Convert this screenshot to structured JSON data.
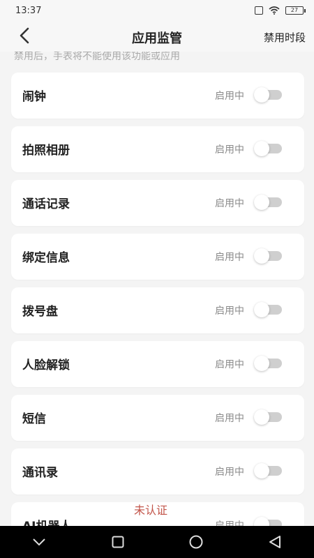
{
  "status": {
    "time": "13:37",
    "battery": "27"
  },
  "header": {
    "title": "应用监管",
    "right_action": "禁用时段"
  },
  "hint": "禁用后，手表将不能使用该功能或应用",
  "apps": [
    {
      "name": "闹钟",
      "state": "启用中"
    },
    {
      "name": "拍照相册",
      "state": "启用中"
    },
    {
      "name": "通话记录",
      "state": "启用中"
    },
    {
      "name": "绑定信息",
      "state": "启用中"
    },
    {
      "name": "拨号盘",
      "state": "启用中"
    },
    {
      "name": "人脸解锁",
      "state": "启用中"
    },
    {
      "name": "短信",
      "state": "启用中"
    },
    {
      "name": "通讯录",
      "state": "启用中"
    },
    {
      "name": "AI机器人",
      "state": "启用中",
      "badge": "未认证"
    }
  ],
  "icons": {
    "back": "chevron-left-icon",
    "vibrate": "vibrate-icon",
    "wifi": "wifi-icon",
    "battery": "battery-icon",
    "nav_down": "chevron-down-icon",
    "nav_home": "circle-icon",
    "nav_recent": "square-icon",
    "nav_back": "triangle-back-icon"
  },
  "colors": {
    "badge": "#c2554a",
    "toggle_off": "#cfcfcf"
  }
}
